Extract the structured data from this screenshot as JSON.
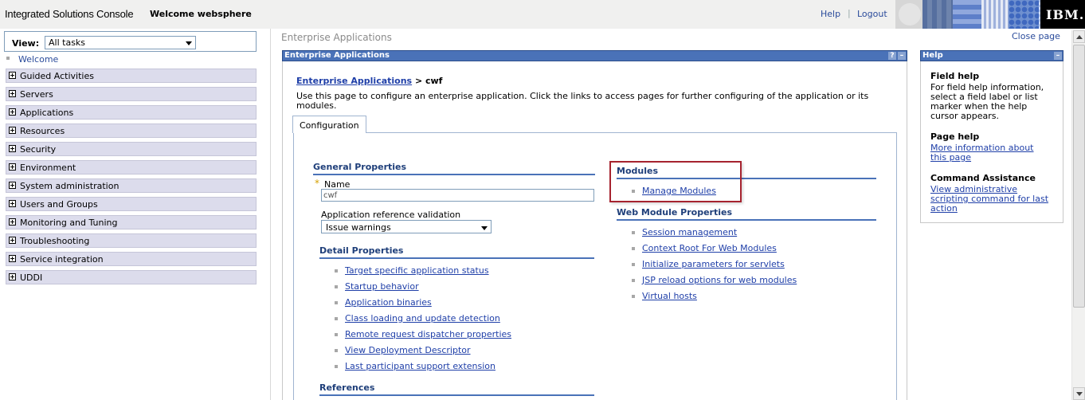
{
  "header": {
    "console_title": "Integrated Solutions Console",
    "welcome": "Welcome websphere",
    "help": "Help",
    "separator": "|",
    "logout": "Logout",
    "logo": "IBM."
  },
  "nav": {
    "view_label": "View:",
    "view_value": "All tasks",
    "welcome": "Welcome",
    "items": [
      "Guided Activities",
      "Servers",
      "Applications",
      "Resources",
      "Security",
      "Environment",
      "System administration",
      "Users and Groups",
      "Monitoring and Tuning",
      "Troubleshooting",
      "Service integration",
      "UDDI"
    ]
  },
  "main": {
    "page_title": "Enterprise Applications",
    "close_page": "Close page",
    "panel_title": "Enterprise Applications",
    "panel_help_btn": "?",
    "panel_min_btn": "–",
    "breadcrumb_link": "Enterprise Applications",
    "breadcrumb_sep": " > ",
    "breadcrumb_current": "cwf",
    "description": "Use this page to configure an enterprise application. Click the links to access pages for further configuring of the application or its modules.",
    "tab": "Configuration",
    "general_properties": "General Properties",
    "required_star": "*",
    "name_label": "Name",
    "name_value": "cwf",
    "arv_label": "Application reference validation",
    "arv_value": "Issue warnings",
    "detail_properties": "Detail Properties",
    "detail_links": [
      "Target specific application status",
      "Startup behavior",
      "Application binaries",
      "Class loading and update detection",
      "Remote request dispatcher properties",
      "View Deployment Descriptor",
      "Last participant support extension"
    ],
    "references": "References",
    "modules": "Modules",
    "manage_modules": "Manage Modules",
    "web_module_properties": "Web Module Properties",
    "web_links": [
      "Session management",
      "Context Root For Web Modules",
      "Initialize parameters for servlets",
      "JSP reload options for web modules",
      "Virtual hosts"
    ]
  },
  "help": {
    "title": "Help",
    "min_btn": "–",
    "field_help_title": "Field help",
    "field_help_text": "For field help information, select a field label or list marker when the help cursor appears.",
    "page_help_title": "Page help",
    "page_help_link": "More information about this page",
    "command_title": "Command Assistance",
    "command_link": "View administrative scripting command for last action"
  }
}
